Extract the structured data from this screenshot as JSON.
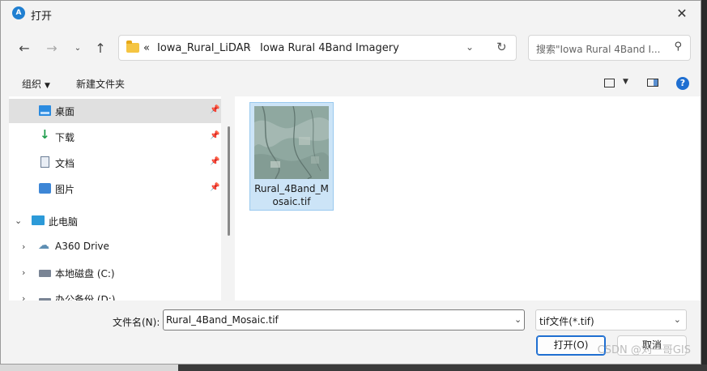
{
  "window": {
    "title": "打开",
    "app_icon": "autodesk-icon"
  },
  "nav": {
    "breadcrumb_overflow": "«",
    "path": [
      "Iowa_Rural_LiDAR",
      "Iowa Rural 4Band Imagery"
    ],
    "separator": "›",
    "search_placeholder": "搜索\"Iowa Rural 4Band I..."
  },
  "toolbar": {
    "organize": "组织",
    "new_folder": "新建文件夹"
  },
  "sidebar": {
    "quick_access": [
      {
        "label": "桌面",
        "icon": "desktop-icon",
        "pinned": true
      },
      {
        "label": "下载",
        "icon": "download-icon",
        "pinned": true
      },
      {
        "label": "文档",
        "icon": "document-icon",
        "pinned": true
      },
      {
        "label": "图片",
        "icon": "picture-icon",
        "pinned": true
      }
    ],
    "this_pc": "此电脑",
    "drives": [
      {
        "label": "A360 Drive",
        "icon": "cloud-drive-icon"
      },
      {
        "label": "本地磁盘 (C:)",
        "icon": "disk-icon"
      },
      {
        "label": "办公备份 (D:)",
        "icon": "disk-icon"
      }
    ]
  },
  "files": [
    {
      "name": "Rural_4Band_Mosaic.tif",
      "selected": true
    }
  ],
  "footer": {
    "filename_label": "文件名(N):",
    "filename_value": "Rural_4Band_Mosaic.tif",
    "filetype": "tif文件(*.tif)",
    "open_button": "打开(O)",
    "cancel_button": "取消"
  },
  "watermark": "CSDN @刘一哥GIS",
  "colors": {
    "accent": "#1f6fd1",
    "selection": "#cce4f7",
    "selection_border": "#99c9ef"
  }
}
